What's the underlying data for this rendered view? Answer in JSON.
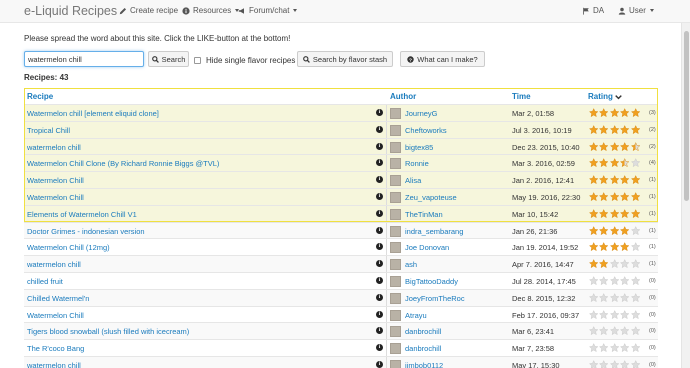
{
  "navbar": {
    "brand": "e-Liquid Recipes",
    "create_recipe": "Create recipe",
    "resources": "Resources",
    "forum_chat": "Forum/chat",
    "language": "DA",
    "user": "User"
  },
  "notice": "Please spread the word about this site. Click the LIKE-button at the bottom!",
  "search": {
    "value": "watermelon chill",
    "button": "Search",
    "hide_single_label": "Hide single flavor recipes",
    "hide_single_checked": false,
    "stash_button": "Search by flavor stash",
    "what_can_button": "What can I make?"
  },
  "recipes_count": "Recipes: 43",
  "table": {
    "headers": {
      "recipe": "Recipe",
      "author": "Author",
      "time": "Time",
      "rating": "Rating"
    },
    "sort_indicator": "chevron-down",
    "rows": [
      {
        "name": "Watermelon chill [element eliquid clone]",
        "author": "JourneyG",
        "time": "Mar 2, 01:58",
        "rating": 5,
        "votes": "(3)",
        "highlight": true
      },
      {
        "name": "Tropical Chill",
        "author": "Cheftoworks",
        "time": "Jul 3. 2016, 10:19",
        "rating": 5,
        "votes": "(2)",
        "highlight": true
      },
      {
        "name": "watermelon chill",
        "author": "bigtex85",
        "time": "Dec 23. 2015, 10:40",
        "rating": 4.5,
        "votes": "(2)",
        "highlight": true
      },
      {
        "name": "Watermelon Chill Clone (By Richard Ronnie Biggs @TVL)",
        "author": "Ronnie",
        "time": "Mar 3. 2016, 02:59",
        "rating": 3.5,
        "votes": "(4)",
        "highlight": true
      },
      {
        "name": "Watermelon Chill",
        "author": "Alisa",
        "time": "Jan 2. 2016, 12:41",
        "rating": 5,
        "votes": "(1)",
        "highlight": true
      },
      {
        "name": "Watermelon Chill",
        "author": "Zeu_vapoteuse",
        "time": "May 19. 2016, 22:30",
        "rating": 5,
        "votes": "(1)",
        "highlight": true
      },
      {
        "name": "Elements of Watermelon Chill V1",
        "author": "TheTinMan",
        "time": "Mar 10, 15:42",
        "rating": 5,
        "votes": "(1)",
        "highlight": true
      },
      {
        "name": "Doctor Grimes - indonesian version",
        "author": "indra_sembarang",
        "time": "Jan 26, 21:36",
        "rating": 4,
        "votes": "(1)",
        "highlight": false
      },
      {
        "name": "Watermelon Chill (12mg)",
        "author": "Joe Donovan",
        "time": "Jan 19. 2014, 19:52",
        "rating": 4,
        "votes": "(1)",
        "highlight": false
      },
      {
        "name": "watermelon chill",
        "author": "ash",
        "time": "Apr 7. 2016, 14:47",
        "rating": 2,
        "votes": "(1)",
        "highlight": false
      },
      {
        "name": "chilled fruit",
        "author": "BigTattooDaddy",
        "time": "Jul 28. 2014, 17:45",
        "rating": 0,
        "votes": "(0)",
        "highlight": false
      },
      {
        "name": "Chilled Watermel'n",
        "author": "JoeyFromTheRoc",
        "time": "Dec 8. 2015, 12:32",
        "rating": 0,
        "votes": "(0)",
        "highlight": false
      },
      {
        "name": "Watermelon Chill",
        "author": "Atrayu",
        "time": "Feb 17. 2016, 09:37",
        "rating": 0,
        "votes": "(0)",
        "highlight": false
      },
      {
        "name": "Tigers blood snowball (slush filled with icecream)",
        "author": "danbrochill",
        "time": "Mar 6, 23:41",
        "rating": 0,
        "votes": "(0)",
        "highlight": false
      },
      {
        "name": "The R'coco Bang",
        "author": "danbrochill",
        "time": "Mar 7, 23:58",
        "rating": 0,
        "votes": "(0)",
        "highlight": false
      },
      {
        "name": "watermelon chill",
        "author": "jimbob0112",
        "time": "May 17, 15:30",
        "rating": 0,
        "votes": "(0)",
        "highlight": false
      }
    ]
  },
  "colors": {
    "link": "#1a7bbd",
    "star_filled": "#f0a020",
    "star_empty": "#dddddd",
    "highlight_border": "#f0e040",
    "highlight_bg": "#f6f6dc"
  }
}
